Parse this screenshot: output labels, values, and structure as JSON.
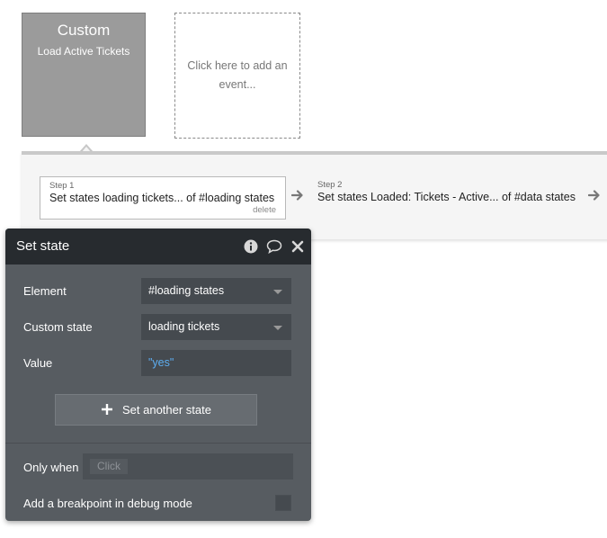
{
  "event": {
    "type": "Custom",
    "name": "Load Active Tickets"
  },
  "add_event": {
    "text": "Click here to add an event..."
  },
  "steps": [
    {
      "label": "Step 1",
      "title": "Set states loading tickets... of #loading states",
      "delete": "delete"
    },
    {
      "label": "Step 2",
      "title": "Set states Loaded: Tickets - Active... of #data states"
    }
  ],
  "panel": {
    "title": "Set state",
    "icons": [
      "info-icon",
      "comment-icon",
      "close-icon"
    ],
    "element_label": "Element",
    "element_value": "#loading states",
    "custom_state_label": "Custom state",
    "custom_state_value": "loading tickets",
    "value_label": "Value",
    "value_value": "\"yes\"",
    "set_another_label": "Set another state",
    "only_when_label": "Only when",
    "only_when_placeholder": "Click",
    "breakpoint_label": "Add a breakpoint in debug mode",
    "breakpoint_checked": false
  },
  "colors": {
    "panel_bg": "#575c61",
    "panel_header": "#272b2f",
    "value_text": "#5dadf0",
    "event_card": "#9b9b9b"
  }
}
